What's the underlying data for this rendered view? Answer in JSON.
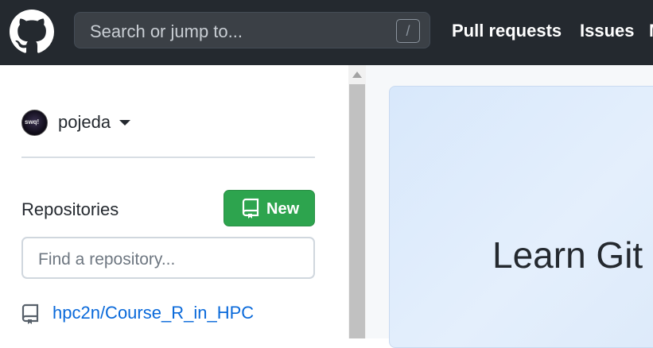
{
  "header": {
    "logo_icon": "github-mark-icon",
    "search_placeholder": "Search or jump to...",
    "search_shortcut": "/",
    "nav": {
      "pull_requests": "Pull requests",
      "issues": "Issues",
      "more": "M"
    }
  },
  "sidebar": {
    "user": {
      "avatar_icon": "user-avatar",
      "avatar_text": "swq!",
      "username": "pojeda",
      "menu_icon": "caret-down-icon"
    },
    "repositories": {
      "title": "Repositories",
      "new_button_label": "New",
      "new_button_icon": "repo-icon",
      "find_placeholder": "Find a repository...",
      "items": [
        {
          "icon": "repo-icon",
          "name": "hpc2n/Course_R_in_HPC"
        }
      ]
    }
  },
  "main": {
    "card_title": "Learn Git"
  },
  "colors": {
    "header_bg": "#24292f",
    "accent_green": "#2da44e",
    "link_blue": "#0969da",
    "card_bg": "#dde9fb"
  }
}
